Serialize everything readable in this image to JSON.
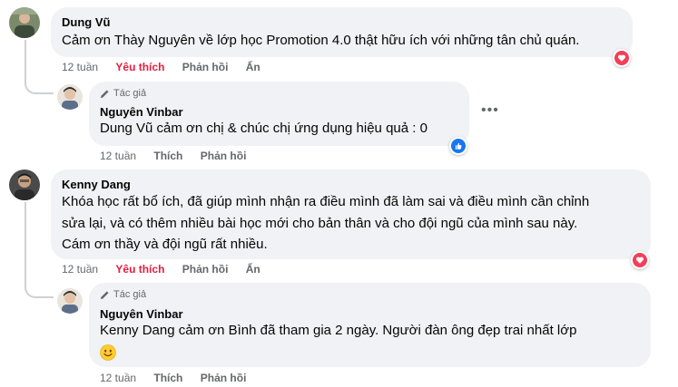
{
  "comments": [
    {
      "author": "Dung Vũ",
      "text": "Cảm ơn Thày Nguyên về lớp học Promotion 4.0 thật hữu ích với những tân chủ quán.",
      "time": "12 tuần",
      "like_label": "Yêu thích",
      "reply_label": "Phản hồi",
      "hide_label": "Ẩn",
      "reaction_icon": "heart-icon",
      "reply": {
        "badge": "Tác giả",
        "author": "Nguyên Vinbar",
        "tag": "Dung Vũ",
        "text": "cảm ơn chị & chúc chị ứng dụng hiệu quả : 0",
        "time": "12 tuần",
        "like_label": "Thích",
        "reply_label": "Phản hồi",
        "reaction_icon": "thumbs-up-icon"
      }
    },
    {
      "author": "Kenny Dang",
      "text_lines": [
        "Khóa học rất bổ ích, đã giúp mình nhận ra điều mình đã làm sai và điều mình cần chỉnh",
        "sửa lại, và có thêm nhiều bài học mới cho bản thân và cho đội ngũ của mình sau này.",
        "Cám ơn thầy và đội ngũ rất nhiều."
      ],
      "time": "12 tuần",
      "like_label": "Yêu thích",
      "reply_label": "Phản hồi",
      "hide_label": "Ẩn",
      "reaction_icon": "heart-icon",
      "reply": {
        "badge": "Tác giả",
        "author": "Nguyên Vinbar",
        "tag": "Kenny Dang",
        "text": "cảm ơn Bình đã tham gia 2 ngày. Người đàn ông đẹp trai nhất lớp",
        "emoji": "smiling-face-emoji",
        "time": "12 tuần",
        "like_label": "Thích",
        "reply_label": "Phản hồi"
      }
    }
  ],
  "colors": {
    "bubble": "#f0f2f5",
    "meta": "#65676b",
    "love": "#e41e3f",
    "like": "#1877f2"
  },
  "more_icon": "more-options-icon"
}
